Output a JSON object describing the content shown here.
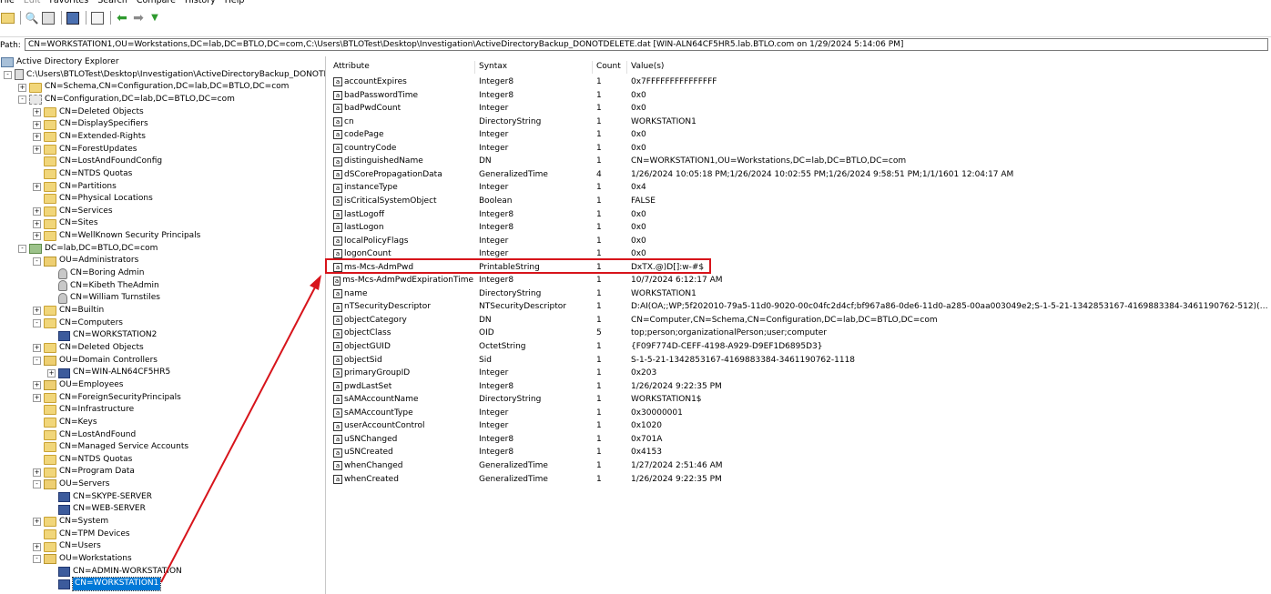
{
  "menu": [
    "File",
    "Edit",
    "Favorites",
    "Search",
    "Compare",
    "History",
    "Help"
  ],
  "toolbar": {
    "icons": [
      "open-folder-icon",
      "search-icon",
      "connect-icon",
      "save-icon",
      "properties-icon",
      "back-icon",
      "forward-icon",
      "dropdown-icon"
    ]
  },
  "path": {
    "label": "Path:",
    "value": "CN=WORKSTATION1,OU=Workstations,DC=lab,DC=BTLO,DC=com,C:\\Users\\BTLOTest\\Desktop\\Investigation\\ActiveDirectoryBackup_DONOTDELETE.dat [WIN-ALN64CF5HR5.lab.BTLO.com on 1/29/2024 5:14:06 PM]"
  },
  "tree": [
    {
      "label": "Active Directory Explorer",
      "icon": "root",
      "depth": 0,
      "exp": ""
    },
    {
      "label": "C:\\Users\\BTLOTest\\Desktop\\Investigation\\ActiveDirectoryBackup_DONOTDELETE.dat",
      "icon": "db",
      "depth": 1,
      "exp": "-"
    },
    {
      "label": "CN=Schema,CN=Configuration,DC=lab,DC=BTLO,DC=com",
      "icon": "folder",
      "depth": 2,
      "exp": "+"
    },
    {
      "label": "CN=Configuration,DC=lab,DC=BTLO,DC=com",
      "icon": "config",
      "depth": 2,
      "exp": "-"
    },
    {
      "label": "CN=Deleted Objects",
      "icon": "folder",
      "depth": 3,
      "exp": "+"
    },
    {
      "label": "CN=DisplaySpecifiers",
      "icon": "folder",
      "depth": 3,
      "exp": "+"
    },
    {
      "label": "CN=Extended-Rights",
      "icon": "folder",
      "depth": 3,
      "exp": "+"
    },
    {
      "label": "CN=ForestUpdates",
      "icon": "folder",
      "depth": 3,
      "exp": "+"
    },
    {
      "label": "CN=LostAndFoundConfig",
      "icon": "folder",
      "depth": 3,
      "exp": ""
    },
    {
      "label": "CN=NTDS Quotas",
      "icon": "folder",
      "depth": 3,
      "exp": ""
    },
    {
      "label": "CN=Partitions",
      "icon": "folder",
      "depth": 3,
      "exp": "+"
    },
    {
      "label": "CN=Physical Locations",
      "icon": "folder",
      "depth": 3,
      "exp": ""
    },
    {
      "label": "CN=Services",
      "icon": "folder",
      "depth": 3,
      "exp": "+"
    },
    {
      "label": "CN=Sites",
      "icon": "folder",
      "depth": 3,
      "exp": "+"
    },
    {
      "label": "CN=WellKnown Security Principals",
      "icon": "folder",
      "depth": 3,
      "exp": "+"
    },
    {
      "label": "DC=lab,DC=BTLO,DC=com",
      "icon": "domain",
      "depth": 2,
      "exp": "-"
    },
    {
      "label": "OU=Administrators",
      "icon": "ou",
      "depth": 3,
      "exp": "-"
    },
    {
      "label": "CN=Boring Admin",
      "icon": "user",
      "depth": 4,
      "exp": ""
    },
    {
      "label": "CN=Kibeth TheAdmin",
      "icon": "user",
      "depth": 4,
      "exp": ""
    },
    {
      "label": "CN=William Turnstiles",
      "icon": "user",
      "depth": 4,
      "exp": ""
    },
    {
      "label": "CN=Builtin",
      "icon": "folder",
      "depth": 3,
      "exp": "+"
    },
    {
      "label": "CN=Computers",
      "icon": "folder",
      "depth": 3,
      "exp": "-"
    },
    {
      "label": "CN=WORKSTATION2",
      "icon": "computer",
      "depth": 4,
      "exp": ""
    },
    {
      "label": "CN=Deleted Objects",
      "icon": "folder",
      "depth": 3,
      "exp": "+"
    },
    {
      "label": "OU=Domain Controllers",
      "icon": "ou",
      "depth": 3,
      "exp": "-"
    },
    {
      "label": "CN=WIN-ALN64CF5HR5",
      "icon": "computer",
      "depth": 4,
      "exp": "+"
    },
    {
      "label": "OU=Employees",
      "icon": "ou",
      "depth": 3,
      "exp": "+"
    },
    {
      "label": "CN=ForeignSecurityPrincipals",
      "icon": "folder",
      "depth": 3,
      "exp": "+"
    },
    {
      "label": "CN=Infrastructure",
      "icon": "folder",
      "depth": 3,
      "exp": ""
    },
    {
      "label": "CN=Keys",
      "icon": "folder",
      "depth": 3,
      "exp": ""
    },
    {
      "label": "CN=LostAndFound",
      "icon": "folder",
      "depth": 3,
      "exp": ""
    },
    {
      "label": "CN=Managed Service Accounts",
      "icon": "folder",
      "depth": 3,
      "exp": ""
    },
    {
      "label": "CN=NTDS Quotas",
      "icon": "folder",
      "depth": 3,
      "exp": ""
    },
    {
      "label": "CN=Program Data",
      "icon": "folder",
      "depth": 3,
      "exp": "+"
    },
    {
      "label": "OU=Servers",
      "icon": "ou",
      "depth": 3,
      "exp": "-"
    },
    {
      "label": "CN=SKYPE-SERVER",
      "icon": "computer",
      "depth": 4,
      "exp": ""
    },
    {
      "label": "CN=WEB-SERVER",
      "icon": "computer",
      "depth": 4,
      "exp": ""
    },
    {
      "label": "CN=System",
      "icon": "folder",
      "depth": 3,
      "exp": "+"
    },
    {
      "label": "CN=TPM Devices",
      "icon": "folder",
      "depth": 3,
      "exp": ""
    },
    {
      "label": "CN=Users",
      "icon": "folder",
      "depth": 3,
      "exp": "+"
    },
    {
      "label": "OU=Workstations",
      "icon": "ou",
      "depth": 3,
      "exp": "-"
    },
    {
      "label": "CN=ADMIN-WORKSTATION",
      "icon": "computer",
      "depth": 4,
      "exp": ""
    },
    {
      "label": "CN=WORKSTATION1",
      "icon": "computer",
      "depth": 4,
      "exp": "",
      "selected": true
    }
  ],
  "attributes": {
    "headers": [
      "Attribute",
      "Syntax",
      "Count",
      "Value(s)"
    ],
    "rows": [
      [
        "accountExpires",
        "Integer8",
        "1",
        "0x7FFFFFFFFFFFFFFF"
      ],
      [
        "badPasswordTime",
        "Integer8",
        "1",
        "0x0"
      ],
      [
        "badPwdCount",
        "Integer",
        "1",
        "0x0"
      ],
      [
        "cn",
        "DirectoryString",
        "1",
        "WORKSTATION1"
      ],
      [
        "codePage",
        "Integer",
        "1",
        "0x0"
      ],
      [
        "countryCode",
        "Integer",
        "1",
        "0x0"
      ],
      [
        "distinguishedName",
        "DN",
        "1",
        "CN=WORKSTATION1,OU=Workstations,DC=lab,DC=BTLO,DC=com"
      ],
      [
        "dSCorePropagationData",
        "GeneralizedTime",
        "4",
        "1/26/2024 10:05:18 PM;1/26/2024 10:02:55 PM;1/26/2024 9:58:51 PM;1/1/1601 12:04:17 AM"
      ],
      [
        "instanceType",
        "Integer",
        "1",
        "0x4"
      ],
      [
        "isCriticalSystemObject",
        "Boolean",
        "1",
        "FALSE"
      ],
      [
        "lastLogoff",
        "Integer8",
        "1",
        "0x0"
      ],
      [
        "lastLogon",
        "Integer8",
        "1",
        "0x0"
      ],
      [
        "localPolicyFlags",
        "Integer",
        "1",
        "0x0"
      ],
      [
        "logonCount",
        "Integer",
        "1",
        "0x0"
      ],
      [
        "ms-Mcs-AdmPwd",
        "PrintableString",
        "1",
        "DxTX.@)D[]:w-#$"
      ],
      [
        "ms-Mcs-AdmPwdExpirationTime",
        "Integer8",
        "1",
        "10/7/2024 6:12:17 AM"
      ],
      [
        "name",
        "DirectoryString",
        "1",
        "WORKSTATION1"
      ],
      [
        "nTSecurityDescriptor",
        "NTSecurityDescriptor",
        "1",
        "D:AI(OA;;WP;5f202010-79a5-11d0-9020-00c04fc2d4cf;bf967a86-0de6-11d0-a285-00aa003049e2;S-1-5-21-1342853167-4169883384-3461190762-512)(OA;;..."
      ],
      [
        "objectCategory",
        "DN",
        "1",
        "CN=Computer,CN=Schema,CN=Configuration,DC=lab,DC=BTLO,DC=com"
      ],
      [
        "objectClass",
        "OID",
        "5",
        "top;person;organizationalPerson;user;computer"
      ],
      [
        "objectGUID",
        "OctetString",
        "1",
        "{F09F774D-CEFF-4198-A929-D9EF1D6895D3}"
      ],
      [
        "objectSid",
        "Sid",
        "1",
        "S-1-5-21-1342853167-4169883384-3461190762-1118"
      ],
      [
        "primaryGroupID",
        "Integer",
        "1",
        "0x203"
      ],
      [
        "pwdLastSet",
        "Integer8",
        "1",
        "1/26/2024 9:22:35 PM"
      ],
      [
        "sAMAccountName",
        "DirectoryString",
        "1",
        "WORKSTATION1$"
      ],
      [
        "sAMAccountType",
        "Integer",
        "1",
        "0x30000001"
      ],
      [
        "userAccountControl",
        "Integer",
        "1",
        "0x1020"
      ],
      [
        "uSNChanged",
        "Integer8",
        "1",
        "0x701A"
      ],
      [
        "uSNCreated",
        "Integer8",
        "1",
        "0x4153"
      ],
      [
        "whenChanged",
        "GeneralizedTime",
        "1",
        "1/27/2024 2:51:46 AM"
      ],
      [
        "whenCreated",
        "GeneralizedTime",
        "1",
        "1/26/2024 9:22:35 PM"
      ]
    ]
  },
  "annotation": {
    "color": "#d7141b",
    "highlighted_row": "ms-Mcs-AdmPwd"
  }
}
